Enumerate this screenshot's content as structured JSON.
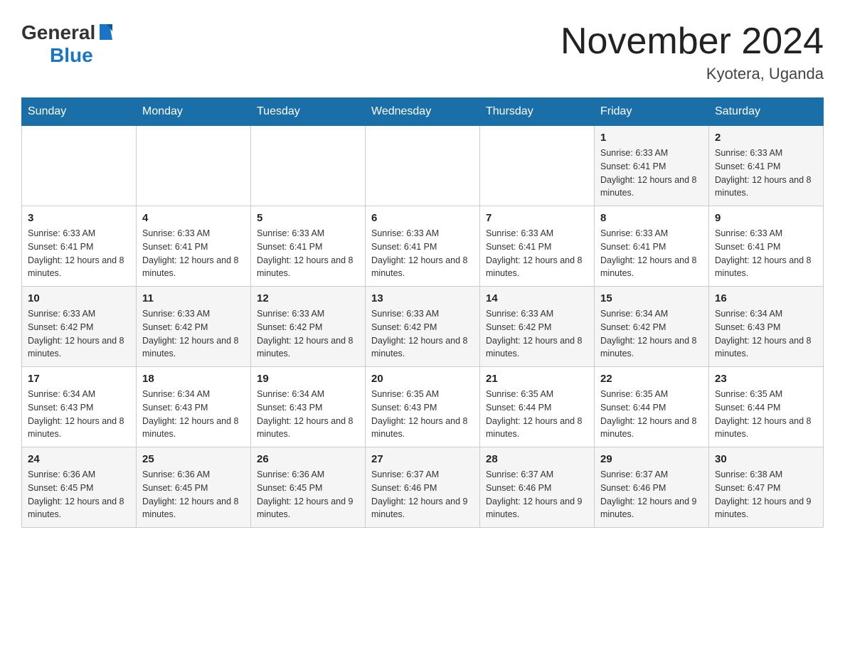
{
  "header": {
    "logo": {
      "general": "General",
      "blue": "Blue"
    },
    "title": "November 2024",
    "location": "Kyotera, Uganda"
  },
  "weekdays": [
    "Sunday",
    "Monday",
    "Tuesday",
    "Wednesday",
    "Thursday",
    "Friday",
    "Saturday"
  ],
  "rows": [
    {
      "cells": [
        {
          "day": "",
          "info": ""
        },
        {
          "day": "",
          "info": ""
        },
        {
          "day": "",
          "info": ""
        },
        {
          "day": "",
          "info": ""
        },
        {
          "day": "",
          "info": ""
        },
        {
          "day": "1",
          "info": "Sunrise: 6:33 AM\nSunset: 6:41 PM\nDaylight: 12 hours and 8 minutes."
        },
        {
          "day": "2",
          "info": "Sunrise: 6:33 AM\nSunset: 6:41 PM\nDaylight: 12 hours and 8 minutes."
        }
      ]
    },
    {
      "cells": [
        {
          "day": "3",
          "info": "Sunrise: 6:33 AM\nSunset: 6:41 PM\nDaylight: 12 hours and 8 minutes."
        },
        {
          "day": "4",
          "info": "Sunrise: 6:33 AM\nSunset: 6:41 PM\nDaylight: 12 hours and 8 minutes."
        },
        {
          "day": "5",
          "info": "Sunrise: 6:33 AM\nSunset: 6:41 PM\nDaylight: 12 hours and 8 minutes."
        },
        {
          "day": "6",
          "info": "Sunrise: 6:33 AM\nSunset: 6:41 PM\nDaylight: 12 hours and 8 minutes."
        },
        {
          "day": "7",
          "info": "Sunrise: 6:33 AM\nSunset: 6:41 PM\nDaylight: 12 hours and 8 minutes."
        },
        {
          "day": "8",
          "info": "Sunrise: 6:33 AM\nSunset: 6:41 PM\nDaylight: 12 hours and 8 minutes."
        },
        {
          "day": "9",
          "info": "Sunrise: 6:33 AM\nSunset: 6:41 PM\nDaylight: 12 hours and 8 minutes."
        }
      ]
    },
    {
      "cells": [
        {
          "day": "10",
          "info": "Sunrise: 6:33 AM\nSunset: 6:42 PM\nDaylight: 12 hours and 8 minutes."
        },
        {
          "day": "11",
          "info": "Sunrise: 6:33 AM\nSunset: 6:42 PM\nDaylight: 12 hours and 8 minutes."
        },
        {
          "day": "12",
          "info": "Sunrise: 6:33 AM\nSunset: 6:42 PM\nDaylight: 12 hours and 8 minutes."
        },
        {
          "day": "13",
          "info": "Sunrise: 6:33 AM\nSunset: 6:42 PM\nDaylight: 12 hours and 8 minutes."
        },
        {
          "day": "14",
          "info": "Sunrise: 6:33 AM\nSunset: 6:42 PM\nDaylight: 12 hours and 8 minutes."
        },
        {
          "day": "15",
          "info": "Sunrise: 6:34 AM\nSunset: 6:42 PM\nDaylight: 12 hours and 8 minutes."
        },
        {
          "day": "16",
          "info": "Sunrise: 6:34 AM\nSunset: 6:43 PM\nDaylight: 12 hours and 8 minutes."
        }
      ]
    },
    {
      "cells": [
        {
          "day": "17",
          "info": "Sunrise: 6:34 AM\nSunset: 6:43 PM\nDaylight: 12 hours and 8 minutes."
        },
        {
          "day": "18",
          "info": "Sunrise: 6:34 AM\nSunset: 6:43 PM\nDaylight: 12 hours and 8 minutes."
        },
        {
          "day": "19",
          "info": "Sunrise: 6:34 AM\nSunset: 6:43 PM\nDaylight: 12 hours and 8 minutes."
        },
        {
          "day": "20",
          "info": "Sunrise: 6:35 AM\nSunset: 6:43 PM\nDaylight: 12 hours and 8 minutes."
        },
        {
          "day": "21",
          "info": "Sunrise: 6:35 AM\nSunset: 6:44 PM\nDaylight: 12 hours and 8 minutes."
        },
        {
          "day": "22",
          "info": "Sunrise: 6:35 AM\nSunset: 6:44 PM\nDaylight: 12 hours and 8 minutes."
        },
        {
          "day": "23",
          "info": "Sunrise: 6:35 AM\nSunset: 6:44 PM\nDaylight: 12 hours and 8 minutes."
        }
      ]
    },
    {
      "cells": [
        {
          "day": "24",
          "info": "Sunrise: 6:36 AM\nSunset: 6:45 PM\nDaylight: 12 hours and 8 minutes."
        },
        {
          "day": "25",
          "info": "Sunrise: 6:36 AM\nSunset: 6:45 PM\nDaylight: 12 hours and 8 minutes."
        },
        {
          "day": "26",
          "info": "Sunrise: 6:36 AM\nSunset: 6:45 PM\nDaylight: 12 hours and 9 minutes."
        },
        {
          "day": "27",
          "info": "Sunrise: 6:37 AM\nSunset: 6:46 PM\nDaylight: 12 hours and 9 minutes."
        },
        {
          "day": "28",
          "info": "Sunrise: 6:37 AM\nSunset: 6:46 PM\nDaylight: 12 hours and 9 minutes."
        },
        {
          "day": "29",
          "info": "Sunrise: 6:37 AM\nSunset: 6:46 PM\nDaylight: 12 hours and 9 minutes."
        },
        {
          "day": "30",
          "info": "Sunrise: 6:38 AM\nSunset: 6:47 PM\nDaylight: 12 hours and 9 minutes."
        }
      ]
    }
  ]
}
